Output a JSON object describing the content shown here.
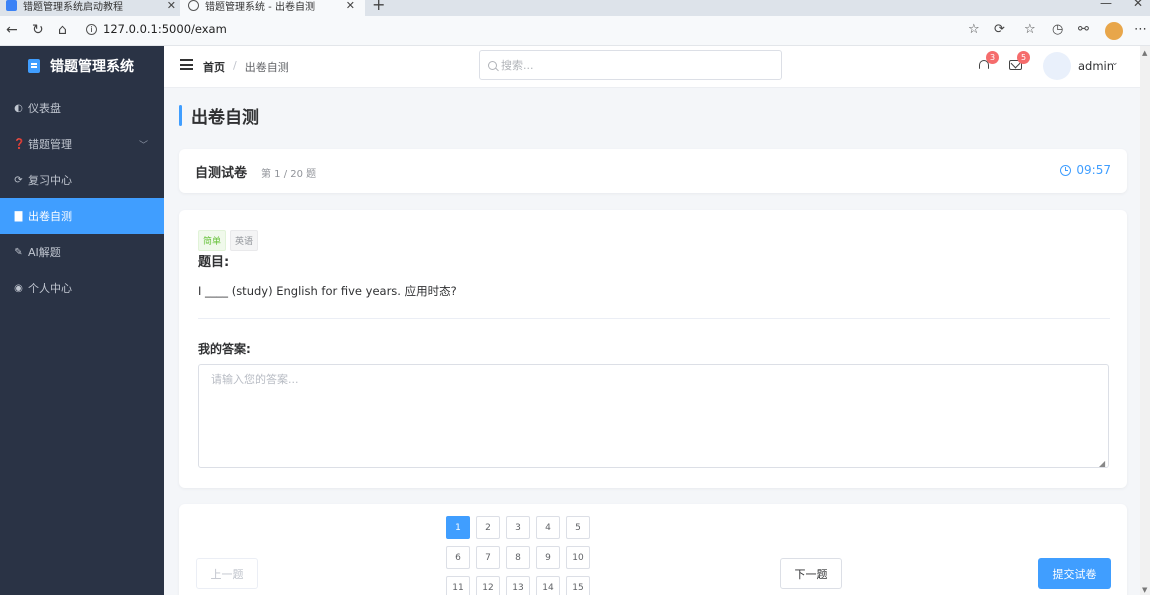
{
  "browser": {
    "tabs": [
      {
        "label": "错题管理系统启动教程"
      },
      {
        "label": "错题管理系统 - 出卷自测"
      }
    ],
    "url": "127.0.0.1:5000/exam"
  },
  "sidebar": {
    "brand": "错题管理系统",
    "items": [
      {
        "label": "仪表盘",
        "icon": "dashboard-icon",
        "active": false
      },
      {
        "label": "错题管理",
        "icon": "question-circle-icon",
        "active": false,
        "has_submenu": true
      },
      {
        "label": "复习中心",
        "icon": "refresh-icon",
        "active": false
      },
      {
        "label": "出卷自测",
        "icon": "file-icon",
        "active": true
      },
      {
        "label": "AI解题",
        "icon": "edit-icon",
        "active": false
      },
      {
        "label": "个人中心",
        "icon": "user-circle-icon",
        "active": false
      }
    ]
  },
  "header": {
    "breadcrumb_home": "首页",
    "breadcrumb_sep": "/",
    "breadcrumb_current": "出卷自测",
    "search_placeholder": "搜索...",
    "notification_count": "3",
    "message_count": "5",
    "username": "admin"
  },
  "page": {
    "title": "出卷自测"
  },
  "paper": {
    "name": "自测试卷",
    "progress": "第 1 / 20 题",
    "timer": "09:57"
  },
  "question": {
    "difficulty": "简单",
    "subject": "英语",
    "label": "题目:",
    "text": "I ____ (study) English for five years. 应用时态?",
    "answer_label": "我的答案:",
    "answer_placeholder": "请输入您的答案...",
    "answer_value": ""
  },
  "navigation": {
    "prev_label": "上一题",
    "next_label": "下一题",
    "submit_label": "提交试卷",
    "current_number": 1,
    "numbers": [
      "1",
      "2",
      "3",
      "4",
      "5",
      "6",
      "7",
      "8",
      "9",
      "10",
      "11",
      "12",
      "13",
      "14",
      "15"
    ]
  },
  "colors": {
    "primary": "#409eff",
    "sidebar_bg": "#2a3345",
    "badge": "#f56c6c"
  }
}
